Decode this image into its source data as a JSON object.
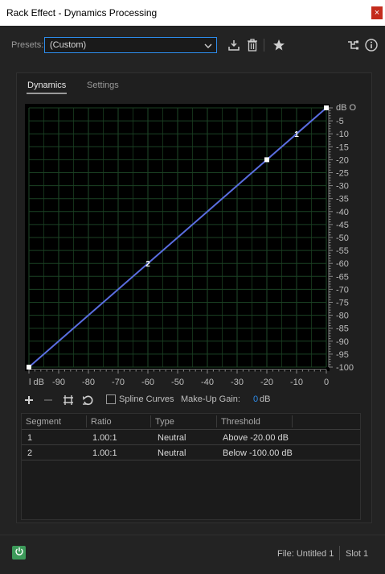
{
  "window": {
    "title": "Rack Effect - Dynamics Processing",
    "close_glyph": "×"
  },
  "presets": {
    "label": "Presets:",
    "value": "(Custom)"
  },
  "toolbar": {
    "icons": [
      "download-preset-icon",
      "trash-icon",
      "star-icon",
      "routing-icon",
      "info-icon"
    ]
  },
  "tabs": [
    {
      "label": "Dynamics",
      "active": true
    },
    {
      "label": "Settings",
      "active": false
    }
  ],
  "chart_data": {
    "type": "line",
    "x_tick_labels": [
      "l dB",
      "-90",
      "-80",
      "-70",
      "-60",
      "-50",
      "-40",
      "-30",
      "-20",
      "-10",
      "0"
    ],
    "y_unit_label": "dB O",
    "y_tick_labels": [
      "-5",
      "-10",
      "-15",
      "-20",
      "-25",
      "-30",
      "-35",
      "-40",
      "-45",
      "-50",
      "-55",
      "-60",
      "-65",
      "-70",
      "-75",
      "-80",
      "-85",
      "-90",
      "-95",
      "-100"
    ],
    "xlim": [
      -100,
      0
    ],
    "ylim": [
      -100,
      0
    ],
    "grid": true,
    "curve_color": "#5a6ee0",
    "points": [
      {
        "x": -100,
        "y": -100
      },
      {
        "x": -20,
        "y": -20
      },
      {
        "x": 0,
        "y": 0
      }
    ],
    "segment_labels": [
      {
        "label": "2",
        "x": -60,
        "y": -60
      },
      {
        "label": "1",
        "x": -10,
        "y": -10
      }
    ]
  },
  "controls": {
    "spline_label": "Spline Curves",
    "spline_checked": false,
    "makeup_label": "Make-Up Gain:",
    "makeup_value": "0",
    "makeup_unit": "dB"
  },
  "segments_table": {
    "headers": [
      "Segment",
      "Ratio",
      "Type",
      "Threshold"
    ],
    "rows": [
      {
        "segment": "1",
        "ratio": "1.00:1",
        "type": "Neutral",
        "threshold": "Above -20.00 dB"
      },
      {
        "segment": "2",
        "ratio": "1.00:1",
        "type": "Neutral",
        "threshold": "Below -100.00 dB"
      }
    ]
  },
  "footer": {
    "file": "File: Untitled 1",
    "slot": "Slot 1"
  },
  "colors": {
    "accent": "#2d8ceb",
    "power": "#3d9a5a",
    "curve": "#5a6ee0",
    "grid": "#1f4a2a",
    "close": "#c42b1c"
  }
}
